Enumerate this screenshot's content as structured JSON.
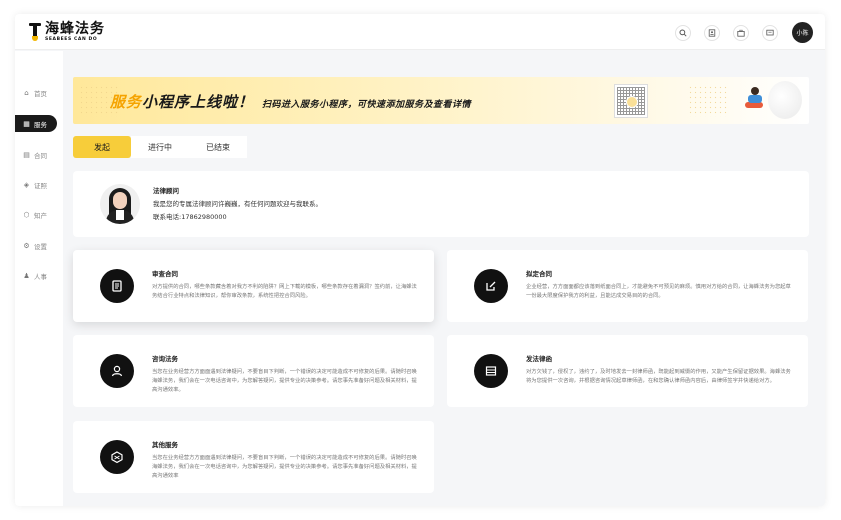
{
  "app": {
    "logo_cn": "海蜂法务",
    "logo_en": "SEABEES CAN DO"
  },
  "header": {
    "icons": [
      "search-icon",
      "contacts-icon",
      "briefcase-icon",
      "message-icon"
    ],
    "user_name": "小陈"
  },
  "sidebar": {
    "items": [
      {
        "label": "首页",
        "icon": "home-icon",
        "active": false
      },
      {
        "label": "服务",
        "icon": "grid-icon",
        "active": true
      },
      {
        "label": "合同",
        "icon": "contract-icon",
        "active": false
      },
      {
        "label": "证照",
        "icon": "certificate-icon",
        "active": false
      },
      {
        "label": "知产",
        "icon": "ip-icon",
        "active": false
      },
      {
        "label": "设置",
        "icon": "gear-icon",
        "active": false
      },
      {
        "label": "人事",
        "icon": "person-icon",
        "active": false
      }
    ]
  },
  "banner": {
    "highlight": "服务",
    "main": "小程序上线啦！",
    "sub": "扫码进入服务小程序，可快速添加服务及查看详情",
    "colors": {
      "accent": "#f5a300",
      "bg": "#ffe89a"
    }
  },
  "tabs": [
    {
      "label": "发起",
      "active": true
    },
    {
      "label": "进行中",
      "active": false
    },
    {
      "label": "已结束",
      "active": false
    }
  ],
  "advisor": {
    "title": "法律顾问",
    "intro": "我是您的专属法律顾问许巍巍，有任何问题欢迎与我联系。",
    "phone": "联系电话:17862980000"
  },
  "services": [
    {
      "title": "审查合同",
      "icon": "document-icon",
      "desc": "对方提供的合同，哪些条款藏含着对我方不利的陷阱？网上下载的模板，哪些条款存在着漏洞？签约前，让海蜂法务结合行业特点和法律知识，帮你审改条款，系统性把控合同风险。"
    },
    {
      "title": "拟定合同",
      "icon": "edit-icon",
      "desc": "企业经营，方方面面都应该落到纸面合同上，才能避免不可预见的麻烦。慎用对方给的合同，让海蜂法务为您起草一份最大限度保护我方的利益，且能达成交易目的的合同。"
    },
    {
      "title": "咨询法务",
      "icon": "consult-icon",
      "desc": "当您在业务经营方方面面遇到法律疑问，不要盲目下判断，一个错误的决定可能造成不可修复的后果。请随时召唤海蜂法务，我们会在一次电话咨询中，为您解答疑问，提供专业的决策参考。请您事先准备好问题及相关材料，提高沟通效率。"
    },
    {
      "title": "发法律函",
      "icon": "letter-icon",
      "desc": "对方欠钱了，侵权了，违约了，及时地发去一封律师函，既能起到威慑的作用，又能产生保留证据效果。海蜂法务将为您提供一次咨询，并根据咨询情况起草律师函，在和您确认律师函内容后，由律师签字并快递给对方。"
    },
    {
      "title": "其他服务",
      "icon": "cube-icon",
      "desc": "当您在业务经营方方面面遇到法律疑问，不要盲目下判断，一个错误的决定可能造成不可修复的后果。请随时召唤海蜂法务，我们会在一次电话咨询中，为您解答疑问，提供专业的决策参考。请您事先准备好问题及相关材料，提高沟通效率"
    }
  ]
}
